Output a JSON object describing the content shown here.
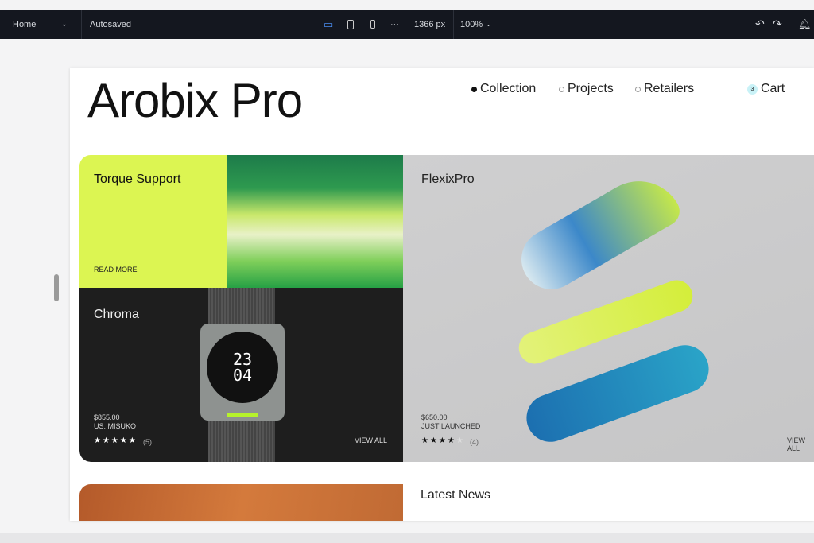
{
  "toolbar": {
    "page_select": "Home",
    "status": "Autosaved",
    "width": "1366 px",
    "zoom": "100%",
    "more": "···"
  },
  "site": {
    "logo": "Arobix Pro",
    "nav": [
      {
        "label": "Collection",
        "active": true
      },
      {
        "label": "Projects",
        "active": false
      },
      {
        "label": "Retailers",
        "active": false
      }
    ],
    "cart": {
      "label": "Cart",
      "count": "3"
    },
    "cards": {
      "torque": {
        "title": "Torque Support",
        "link": "READ MORE"
      },
      "chroma": {
        "title": "Chroma",
        "price": "$855.00",
        "vendor": "US:  MISUKO",
        "stars": "★★★★★",
        "reviews": "(5)",
        "link": "VIEW ALL",
        "watch_time": "23 04"
      },
      "flexix": {
        "title": "FlexixPro",
        "price": "$650.00",
        "status": "JUST LAUNCHED",
        "stars": "★★★★",
        "empty_star": "★",
        "reviews": "(4)",
        "link": "VIEW ALL"
      }
    },
    "news": {
      "title": "Latest News"
    }
  },
  "colors": {
    "accent": "#dcf552",
    "dark": "#1e1e1e",
    "toolbar": "#14171f",
    "badge": "#c9f2f7"
  }
}
